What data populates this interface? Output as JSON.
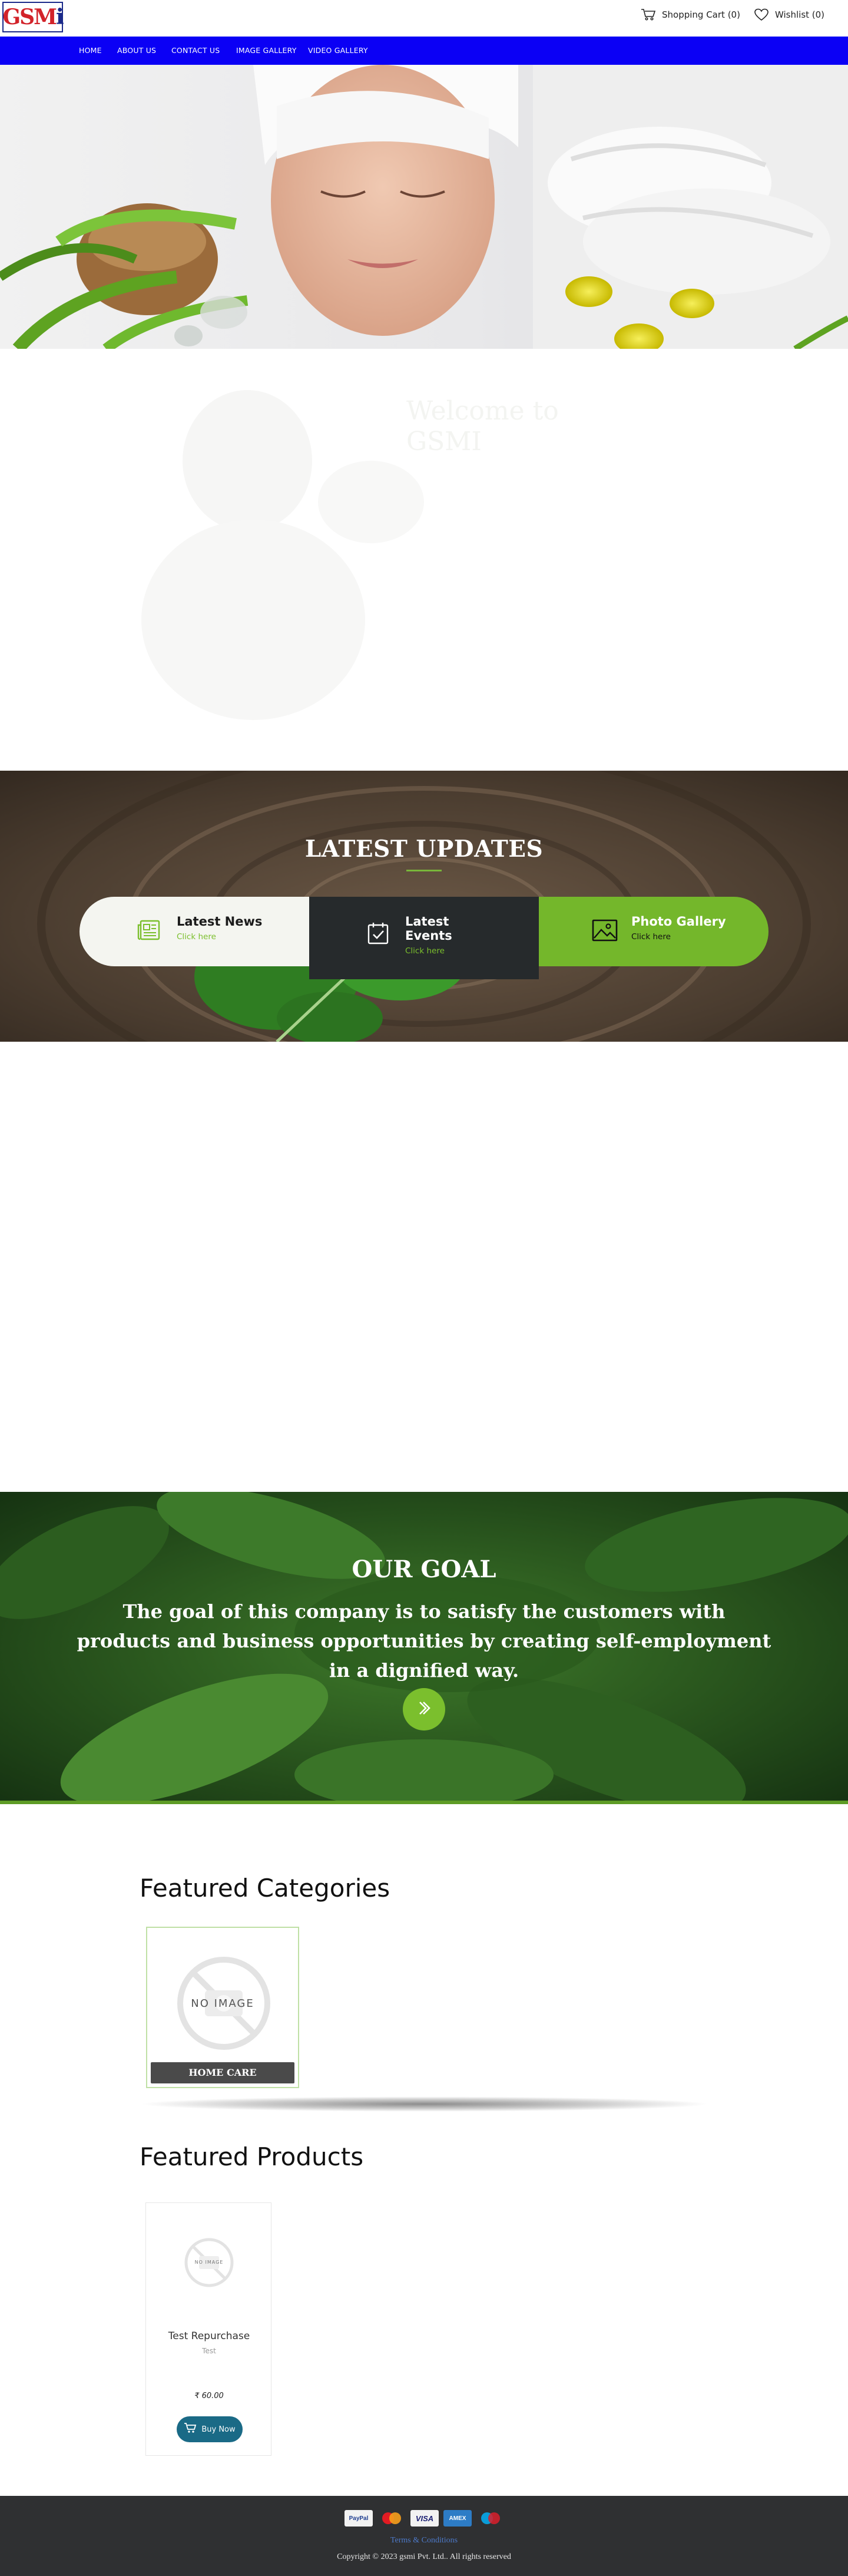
{
  "header": {
    "logo_text": "GSMi",
    "cart_label": "Shopping Cart (0)",
    "wishlist_label": "Wishlist (0)"
  },
  "nav": {
    "items": [
      "HOME",
      "ABOUT US",
      "CONTACT US",
      "IMAGE GALLERY",
      "VIDEO GALLERY"
    ]
  },
  "welcome": {
    "title_line1": "Welcome to",
    "title_line2": "GSMI"
  },
  "updates": {
    "title": "LATEST UPDATES",
    "cards": [
      {
        "title": "Latest News",
        "link": "Click here",
        "icon": "newspaper-icon"
      },
      {
        "title": "Latest Events",
        "link": "Click here",
        "icon": "calendar-check-icon"
      },
      {
        "title": "Photo Gallery",
        "link": "Click here",
        "icon": "image-icon"
      }
    ]
  },
  "goal": {
    "title": "OUR GOAL",
    "text": "The goal of this company is to satisfy the customers with products and business opportunities by creating self-employment in a dignified way.",
    "button_icon": "chevron-right-icon"
  },
  "featured_categories": {
    "title": "Featured Categories",
    "items": [
      {
        "label": "HOME CARE",
        "placeholder": "NO IMAGE"
      }
    ]
  },
  "featured_products": {
    "title": "Featured Products",
    "items": [
      {
        "name": "Test Repurchase",
        "subtitle": "Test",
        "price": "₹ 60.00",
        "button": "Buy Now",
        "placeholder": "NO IMAGE"
      }
    ]
  },
  "footer": {
    "payment_methods": [
      "PayPal",
      "MasterCard",
      "VISA",
      "AMEX",
      "Maestro"
    ],
    "terms": "Terms & Conditions",
    "copyright": "Copyright © 2023 gsmi Pvt. Ltd.. All rights reserved"
  },
  "colors": {
    "nav_bg": "#0b00f5",
    "accent_green": "#7bbf2d",
    "dark_card": "#262a2c",
    "footer_bg": "#2f3032",
    "buy_button": "#1a6a86"
  }
}
